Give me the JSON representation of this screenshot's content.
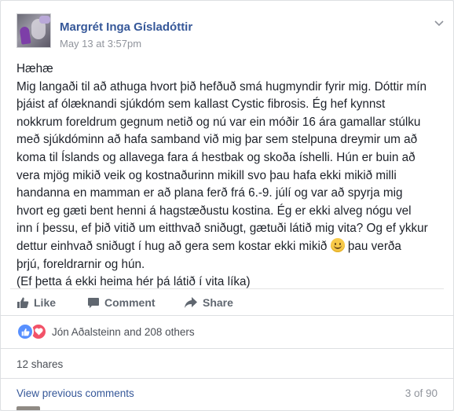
{
  "post": {
    "author": "Margrét Inga Gísladóttir",
    "timestamp": "May 13 at 3:57pm",
    "body_lines": [
      "Hæhæ",
      "Mig langaði til að athuga hvort þið hefðuð smá hugmyndir fyrir mig. Dóttir mín",
      "þjáist af ólæknandi sjúkdóm sem kallast Cystic fibrosis. Ég hef kynnst",
      "nokkrum foreldrum gegnum netið og nú var ein móðir 16 ára gamallar stúlku",
      "með sjúkdóminn að hafa samband við mig þar sem stelpuna dreymir um að",
      "koma til Íslands og allavega fara á hestbak og skoða íshelli. Hún er buin að",
      "vera mjög mikið veik og kostnaðurinn mikill svo þau hafa ekki mikið milli",
      "handanna en mamman er að plana ferð frá 6.-9. júlí og var að spyrja mig",
      "hvort eg gæti bent henni á hagstæðustu kostina. Ég er ekki alveg nógu vel",
      "inn í þessu, ef þið vitið um eitthvað sniðugt, gætuði látið mig vita? Og ef ykkur",
      "dettur einhvað sniðugt í hug að gera sem kostar ekki mikið",
      "þau verða",
      "þrjú, foreldrarnir og hún.",
      "(Ef þetta á ekki heima hér þá látið í vita líka)"
    ],
    "emoji_icon": "slightly-smiling-face-icon"
  },
  "actions": {
    "like": "Like",
    "comment": "Comment",
    "share": "Share"
  },
  "reactions": {
    "icons": [
      "like-reaction-icon",
      "love-reaction-icon"
    ],
    "text": "Jón Aðalsteinn and 208 others"
  },
  "shares": "12 shares",
  "comments": {
    "view_previous": "View previous comments",
    "count": "3 of 90"
  },
  "colors": {
    "link_blue": "#365899",
    "like_blue": "#5890ff",
    "love_red": "#f25268",
    "muted_gray": "#90949c",
    "action_gray": "#606770"
  }
}
